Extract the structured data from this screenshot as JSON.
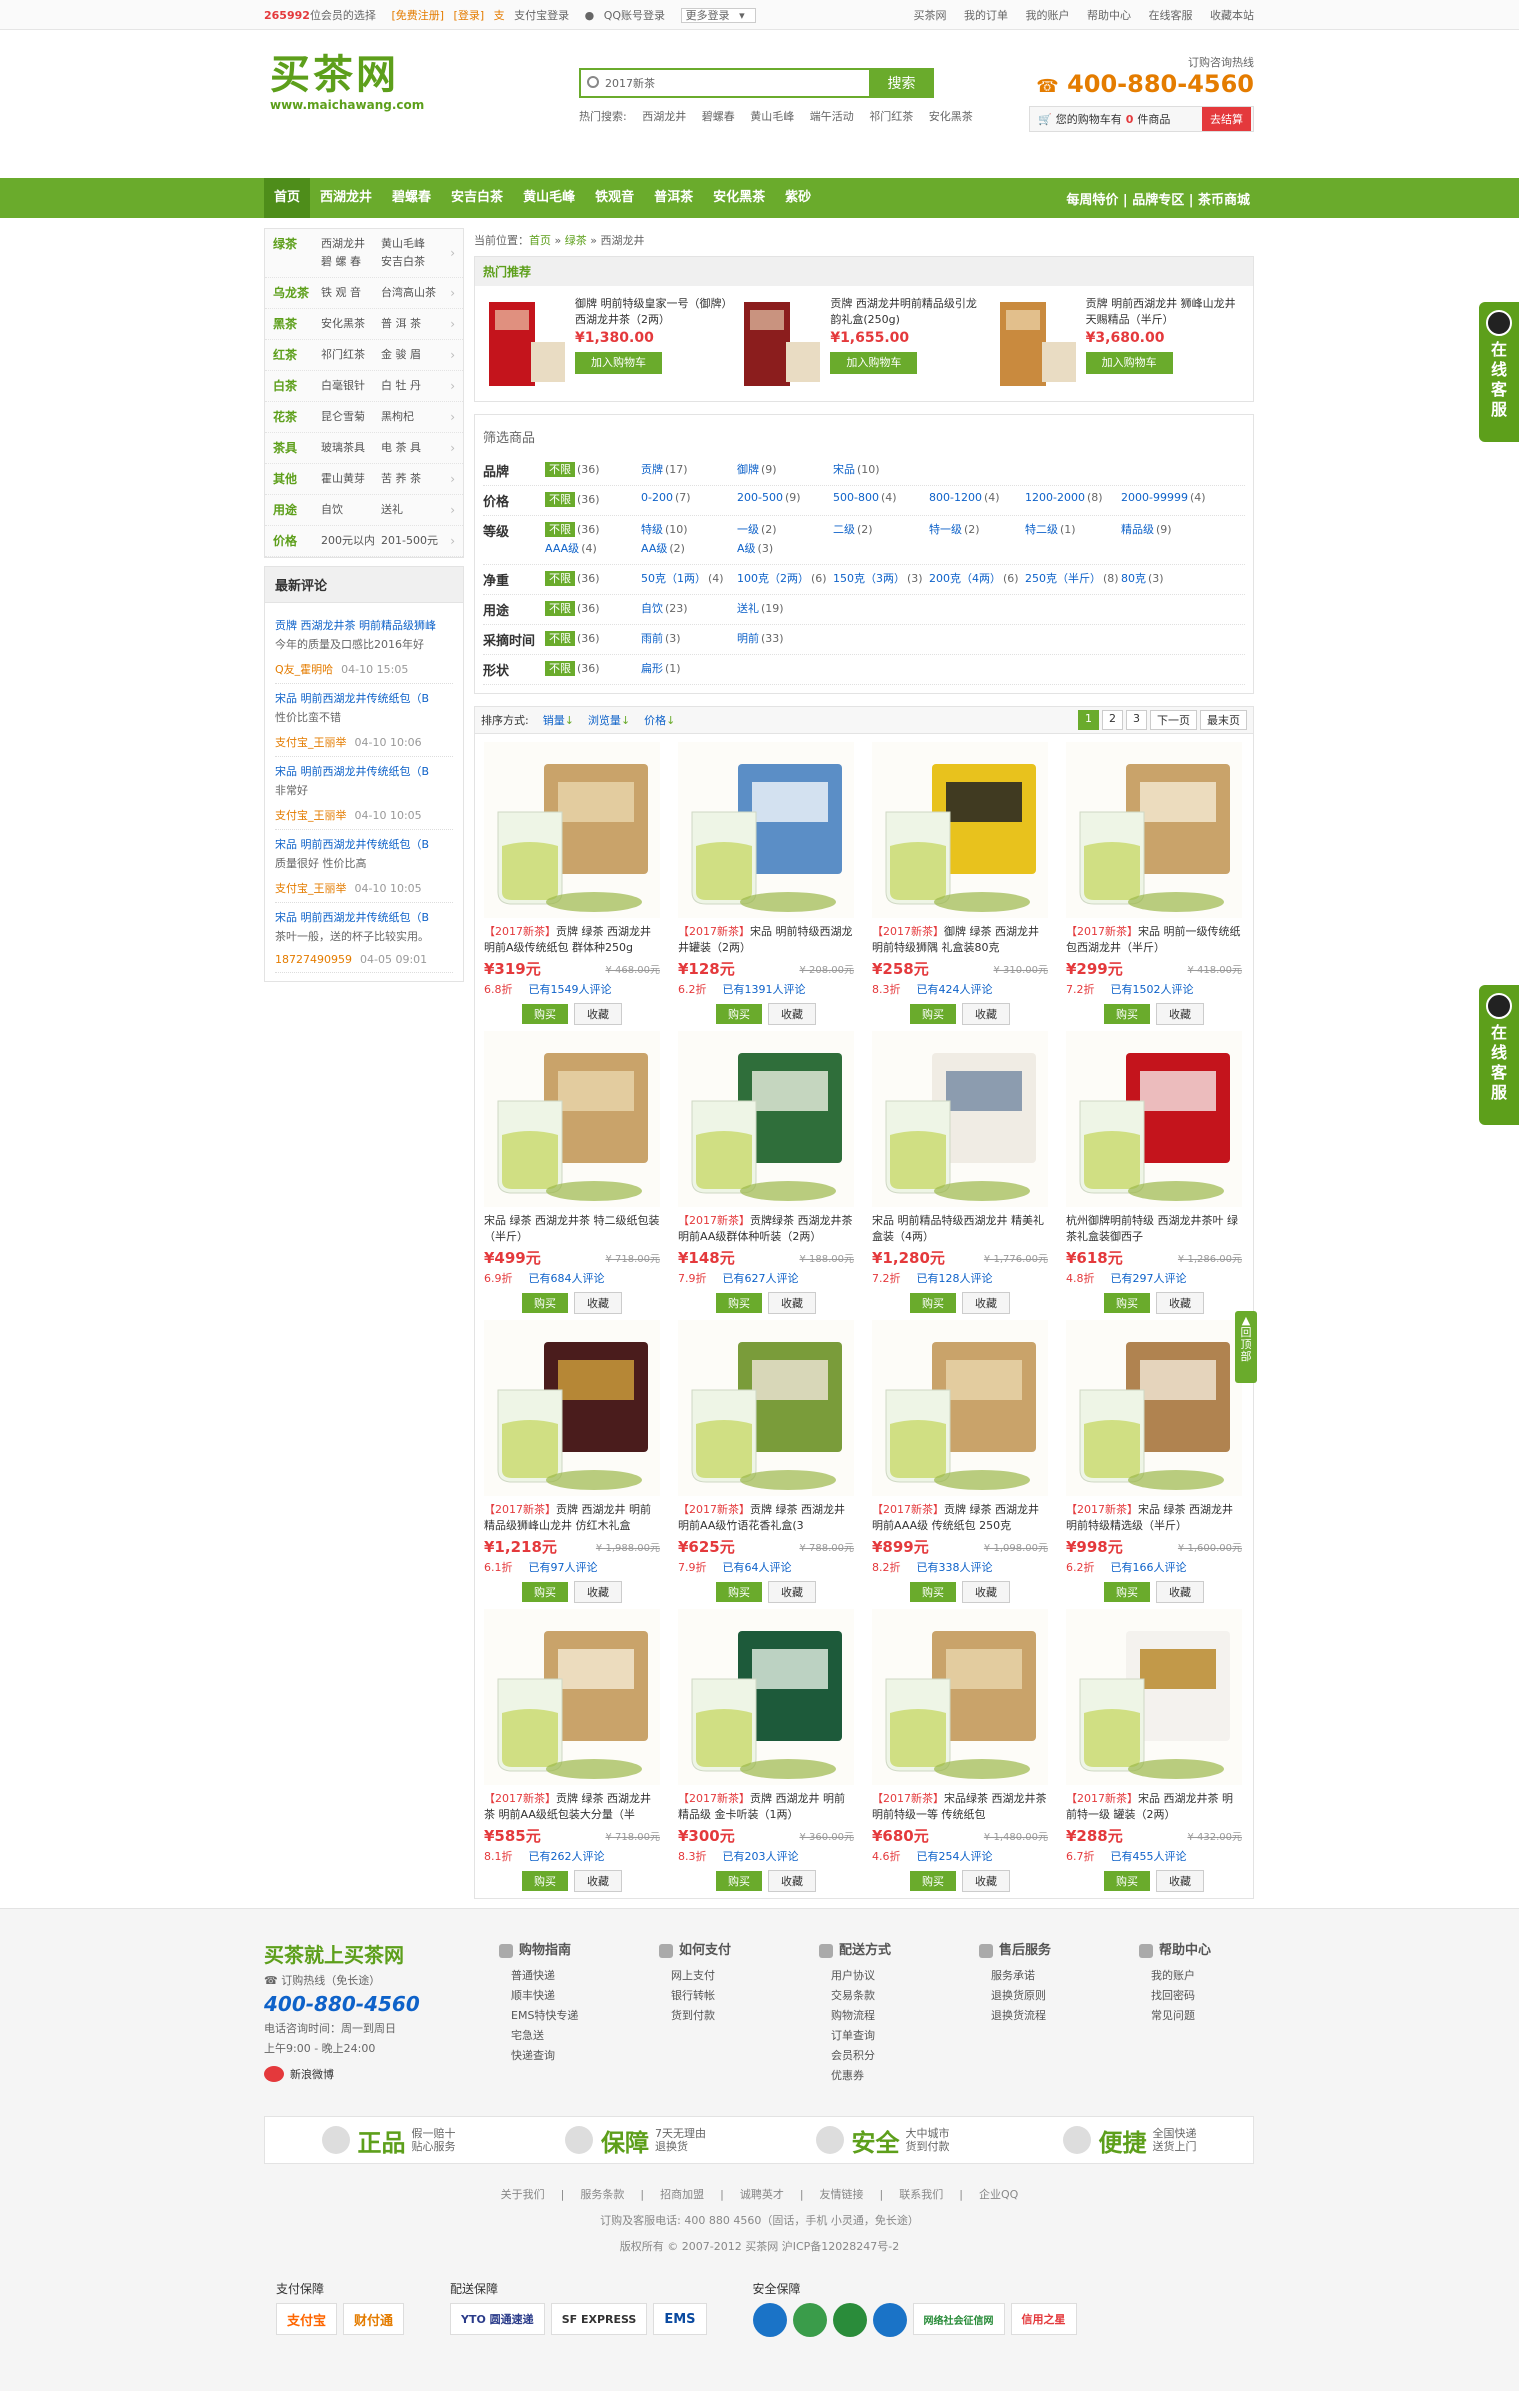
{
  "topbar": {
    "count": "265992",
    "count_suffix": "位会员的选择",
    "register": "[免费注册]",
    "login": "[登录]",
    "alipay_login": "支付宝登录",
    "qq_login": "QQ账号登录",
    "more_login": "更多登录",
    "links": [
      "买茶网",
      "我的订单",
      "我的账户",
      "帮助中心",
      "在线客服",
      "收藏本站"
    ]
  },
  "header": {
    "logo_cn": "买茶网",
    "logo_en": "www.maichawang.com",
    "search_value": "2017新茶",
    "search_button": "搜索",
    "hot_label": "热门搜索:",
    "hot_terms": [
      "西湖龙井",
      "碧螺春",
      "黄山毛峰",
      "端午活动",
      "祁门红茶",
      "安化黑茶"
    ],
    "hotline_label": "订购咨询热线",
    "hotline": "400-880-4560",
    "cart_text": "您的购物车有",
    "cart_count": "0",
    "cart_unit": "件商品",
    "cart_go": "去结算"
  },
  "nav": {
    "items": [
      "首页",
      "西湖龙井",
      "碧螺春",
      "安吉白茶",
      "黄山毛峰",
      "铁观音",
      "普洱茶",
      "安化黑茶",
      "紫砂"
    ],
    "right": "每周特价 | 品牌专区 | 茶币商城"
  },
  "sidebar": {
    "categories": [
      {
        "name": "绿茶",
        "subs": [
          "西湖龙井",
          "黄山毛峰",
          "碧 螺 春",
          "安吉白茶"
        ]
      },
      {
        "name": "乌龙茶",
        "subs": [
          "铁 观 音",
          "台湾高山茶"
        ]
      },
      {
        "name": "黑茶",
        "subs": [
          "安化黑茶",
          "普 洱 茶"
        ]
      },
      {
        "name": "红茶",
        "subs": [
          "祁门红茶",
          "金 骏 眉"
        ]
      },
      {
        "name": "白茶",
        "subs": [
          "白毫银针",
          "白 牡 丹"
        ]
      },
      {
        "name": "花茶",
        "subs": [
          "昆仑雪菊",
          "黑枸杞"
        ]
      },
      {
        "name": "茶具",
        "subs": [
          "玻璃茶具",
          "电 茶 具"
        ]
      },
      {
        "name": "其他",
        "subs": [
          "霍山黄芽",
          "苦 荞 茶"
        ]
      },
      {
        "name": "用途",
        "subs": [
          "自饮",
          "送礼"
        ]
      },
      {
        "name": "价格",
        "subs": [
          "200元以内",
          "201-500元"
        ]
      }
    ],
    "review_title": "最新评论",
    "reviews": [
      {
        "title": "贡牌 西湖龙井茶 明前精品级狮峰",
        "content": "今年的质量及口感比2016年好",
        "user": "Q友_霍明哈",
        "time": "04-10 15:05"
      },
      {
        "title": "宋品 明前西湖龙井传统纸包（B",
        "content": "性价比蛮不错",
        "user": "支付宝_王丽举",
        "time": "04-10 10:06"
      },
      {
        "title": "宋品 明前西湖龙井传统纸包（B",
        "content": "非常好",
        "user": "支付宝_王丽举",
        "time": "04-10 10:05"
      },
      {
        "title": "宋品 明前西湖龙井传统纸包（B",
        "content": "质量很好 性价比高",
        "user": "支付宝_王丽举",
        "time": "04-10 10:05"
      },
      {
        "title": "宋品 明前西湖龙井传统纸包（B",
        "content": "茶叶一般，送的杯子比较实用。",
        "user": "18727490959",
        "time": "04-05 09:01"
      }
    ]
  },
  "breadcrumb": {
    "label": "当前位置：",
    "home": "首页",
    "cat": "绿茶",
    "leaf": "西湖龙井"
  },
  "hot_rec": {
    "title": "热门推荐",
    "items": [
      {
        "name": "御牌 明前特级皇家一号（御牌）西湖龙井茶（2两）",
        "price": "¥1,380.00",
        "btn": "加入购物车"
      },
      {
        "name": "贡牌 西湖龙井明前精品级引龙韵礼盒(250g)",
        "price": "¥1,655.00",
        "btn": "加入购物车"
      },
      {
        "name": "贡牌 明前西湖龙井 狮峰山龙井 天赐精品（半斤）",
        "price": "¥3,680.00",
        "btn": "加入购物车"
      }
    ]
  },
  "filter": {
    "title": "筛选商品",
    "rows": [
      {
        "name": "品牌",
        "opts": [
          [
            "不限",
            "(36)"
          ],
          [
            "贡牌",
            "(17)"
          ],
          [
            "御牌",
            "(9)"
          ],
          [
            "宋品",
            "(10)"
          ]
        ]
      },
      {
        "name": "价格",
        "opts": [
          [
            "不限",
            "(36)"
          ],
          [
            "0-200",
            "(7)"
          ],
          [
            "200-500",
            "(9)"
          ],
          [
            "500-800",
            "(4)"
          ],
          [
            "800-1200",
            "(4)"
          ],
          [
            "1200-2000",
            "(8)"
          ],
          [
            "2000-99999",
            "(4)"
          ]
        ]
      },
      {
        "name": "等级",
        "opts": [
          [
            "不限",
            "(36)"
          ],
          [
            "特级",
            "(10)"
          ],
          [
            "一级",
            "(2)"
          ],
          [
            "二级",
            "(2)"
          ],
          [
            "特一级",
            "(2)"
          ],
          [
            "特二级",
            "(1)"
          ],
          [
            "精品级",
            "(9)"
          ],
          [
            "AAA级",
            "(4)"
          ],
          [
            "AA级",
            "(2)"
          ],
          [
            "A级",
            "(3)"
          ]
        ]
      },
      {
        "name": "净重",
        "opts": [
          [
            "不限",
            "(36)"
          ],
          [
            "50克（1两）",
            "(4)"
          ],
          [
            "100克（2两）",
            "(6)"
          ],
          [
            "150克（3两）",
            "(3)"
          ],
          [
            "200克（4两）",
            "(6)"
          ],
          [
            "250克（半斤）",
            "(8)"
          ],
          [
            "80克",
            "(3)"
          ]
        ]
      },
      {
        "name": "用途",
        "opts": [
          [
            "不限",
            "(36)"
          ],
          [
            "自饮",
            "(23)"
          ],
          [
            "送礼",
            "(19)"
          ]
        ]
      },
      {
        "name": "采摘时间",
        "opts": [
          [
            "不限",
            "(36)"
          ],
          [
            "雨前",
            "(3)"
          ],
          [
            "明前",
            "(33)"
          ]
        ]
      },
      {
        "name": "形状",
        "opts": [
          [
            "不限",
            "(36)"
          ],
          [
            "扁形",
            "(1)"
          ]
        ]
      }
    ]
  },
  "sort": {
    "label": "排序方式:",
    "options": [
      "销量",
      "浏览量",
      "价格"
    ],
    "pages": [
      "1",
      "2",
      "3"
    ],
    "next": "下一页",
    "last": "最末页"
  },
  "products": [
    {
      "tag": "【2017新茶】",
      "title": "贡牌 绿茶 西湖龙井 明前A级传统纸包 群体种250g",
      "price": "¥319元",
      "old": "¥ 468.00元",
      "disc": "6.8折",
      "rev": "已有1549人评论"
    },
    {
      "tag": "【2017新茶】",
      "title": "宋品 明前特级西湖龙井罐装（2两）",
      "price": "¥128元",
      "old": "¥ 208.00元",
      "disc": "6.2折",
      "rev": "已有1391人评论"
    },
    {
      "tag": "【2017新茶】",
      "title": "御牌 绿茶 西湖龙井 明前特级狮隅 礼盒装80克",
      "price": "¥258元",
      "old": "¥ 310.00元",
      "disc": "8.3折",
      "rev": "已有424人评论"
    },
    {
      "tag": "【2017新茶】",
      "title": "宋品 明前一级传统纸包西湖龙井（半斤）",
      "price": "¥299元",
      "old": "¥ 418.00元",
      "disc": "7.2折",
      "rev": "已有1502人评论"
    },
    {
      "tag": "",
      "title": "宋品 绿茶 西湖龙井茶 特二级纸包装（半斤）",
      "price": "¥499元",
      "old": "¥ 718.00元",
      "disc": "6.9折",
      "rev": "已有684人评论"
    },
    {
      "tag": "【2017新茶】",
      "title": "贡牌绿茶 西湖龙井茶 明前AA级群体种听装（2两）",
      "price": "¥148元",
      "old": "¥ 188.00元",
      "disc": "7.9折",
      "rev": "已有627人评论"
    },
    {
      "tag": "",
      "title": "宋品 明前精品特级西湖龙井 精美礼盒装（4两）",
      "price": "¥1,280元",
      "old": "¥ 1,776.00元",
      "disc": "7.2折",
      "rev": "已有128人评论"
    },
    {
      "tag": "",
      "title": "杭州御牌明前特级 西湖龙井茶叶 绿茶礼盒装御西子",
      "price": "¥618元",
      "old": "¥ 1,286.00元",
      "disc": "4.8折",
      "rev": "已有297人评论"
    },
    {
      "tag": "【2017新茶】",
      "title": "贡牌 西湖龙井 明前精品级狮峰山龙井 仿红木礼盒",
      "price": "¥1,218元",
      "old": "¥ 1,988.00元",
      "disc": "6.1折",
      "rev": "已有97人评论"
    },
    {
      "tag": "【2017新茶】",
      "title": "贡牌 绿茶 西湖龙井 明前AA级竹语花香礼盒(3",
      "price": "¥625元",
      "old": "¥ 788.00元",
      "disc": "7.9折",
      "rev": "已有64人评论"
    },
    {
      "tag": "【2017新茶】",
      "title": "贡牌 绿茶 西湖龙井 明前AAA级 传统纸包 250克",
      "price": "¥899元",
      "old": "¥ 1,098.00元",
      "disc": "8.2折",
      "rev": "已有338人评论"
    },
    {
      "tag": "【2017新茶】",
      "title": "宋品 绿茶 西湖龙井 明前特级精选级（半斤）",
      "price": "¥998元",
      "old": "¥ 1,600.00元",
      "disc": "6.2折",
      "rev": "已有166人评论"
    },
    {
      "tag": "【2017新茶】",
      "title": "贡牌 绿茶 西湖龙井茶 明前AA级纸包装大分量（半",
      "price": "¥585元",
      "old": "¥ 718.00元",
      "disc": "8.1折",
      "rev": "已有262人评论"
    },
    {
      "tag": "【2017新茶】",
      "title": "贡牌 西湖龙井 明前精品级 金卡听装（1两）",
      "price": "¥300元",
      "old": "¥ 360.00元",
      "disc": "8.3折",
      "rev": "已有203人评论"
    },
    {
      "tag": "【2017新茶】",
      "title": "宋品绿茶 西湖龙井茶 明前特级一等 传统纸包",
      "price": "¥680元",
      "old": "¥ 1,480.00元",
      "disc": "4.6折",
      "rev": "已有254人评论"
    },
    {
      "tag": "【2017新茶】",
      "title": "宋品 西湖龙井茶 明前特一级 罐装（2两）",
      "price": "¥288元",
      "old": "¥ 432.00元",
      "disc": "6.7折",
      "rev": "已有455人评论"
    }
  ],
  "buttons": {
    "buy": "购买",
    "fav": "收藏"
  },
  "side": {
    "qq": "在线客服",
    "top": "回顶部"
  },
  "footer": {
    "brand": "买茶就上买茶网",
    "brand_sub": "订购热线（免长途）",
    "hotline": "400-880-4560",
    "hours_label": "电话咨询时间：周一到周日",
    "hours": "上午9:00 - 晚上24:00",
    "weibo": "新浪微博",
    "cols": [
      {
        "h": "购物指南",
        "items": [
          "普通快递",
          "顺丰快递",
          "EMS特快专递",
          "宅急送",
          "快递查询"
        ]
      },
      {
        "h": "如何支付",
        "items": [
          "网上支付",
          "银行转帐",
          "货到付款"
        ]
      },
      {
        "h": "配送方式",
        "items": [
          "用户协议",
          "交易条款",
          "购物流程",
          "订单查询",
          "会员积分",
          "优惠券"
        ]
      },
      {
        "h": "售后服务",
        "items": [
          "服务承诺",
          "退换货原则",
          "退换货流程"
        ]
      },
      {
        "h": "帮助中心",
        "items": [
          "我的账户",
          "找回密码",
          "常见问题"
        ]
      }
    ],
    "guarantees": [
      {
        "big": "正品",
        "small1": "假一赔十",
        "small2": "贴心服务"
      },
      {
        "big": "保障",
        "small1": "7天无理由",
        "small2": "退换货"
      },
      {
        "big": "安全",
        "small1": "大中城市",
        "small2": "货到付款"
      },
      {
        "big": "便捷",
        "small1": "全国快递",
        "small2": "送货上门"
      }
    ],
    "links": [
      "关于我们",
      "服务条款",
      "招商加盟",
      "诚聘英才",
      "友情链接",
      "联系我们",
      "企业QQ"
    ],
    "contact": "订购及客服电话: 400 880 4560（固话，手机 小灵通，免长途）",
    "copyright": "版权所有 © 2007-2012 买茶网   沪ICP备12028247号-2",
    "pay_title": "支付保障",
    "pay": [
      "支付宝",
      "财付通"
    ],
    "ship_title": "配送保障",
    "ship": [
      "YTO 圆通速递",
      "SF EXPRESS",
      "EMS"
    ],
    "safe_title": "安全保障",
    "safe": [
      "网络社会征信网",
      "信用之星"
    ]
  }
}
